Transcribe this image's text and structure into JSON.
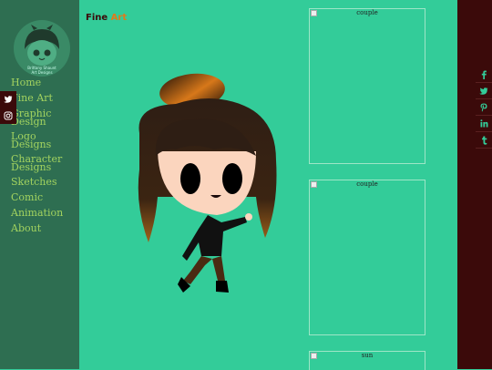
{
  "sidebar": {
    "logo": {
      "subtitle_line1": "Brittany Shaunt",
      "subtitle_line2": "Art Designs"
    },
    "nav": [
      {
        "label": "Home"
      },
      {
        "label": "Fine Art"
      },
      {
        "label": "Graphic Design"
      },
      {
        "label": "Logo Designs"
      },
      {
        "label": "Character Designs"
      },
      {
        "label": "Sketches"
      },
      {
        "label": "Comic"
      },
      {
        "label": "Animation"
      },
      {
        "label": "About"
      }
    ],
    "social": [
      "twitter-icon",
      "instagram-icon"
    ]
  },
  "header": {
    "title_part1": "Fine ",
    "title_part2": "Art"
  },
  "gallery": {
    "thumbnails": [
      {
        "alt": "couple"
      },
      {
        "alt": "couple"
      },
      {
        "alt": "sun"
      }
    ]
  },
  "right_social": [
    "facebook-icon",
    "twitter-icon",
    "pinterest-icon",
    "linkedin-icon",
    "tumblr-icon"
  ],
  "colors": {
    "background": "#33cc99",
    "sidebar": "#2e6e51",
    "accent": "#a3d35f",
    "rightbar": "#3b0a0a",
    "title_dark": "#3b0a0a",
    "title_accent": "#e07a1a"
  }
}
